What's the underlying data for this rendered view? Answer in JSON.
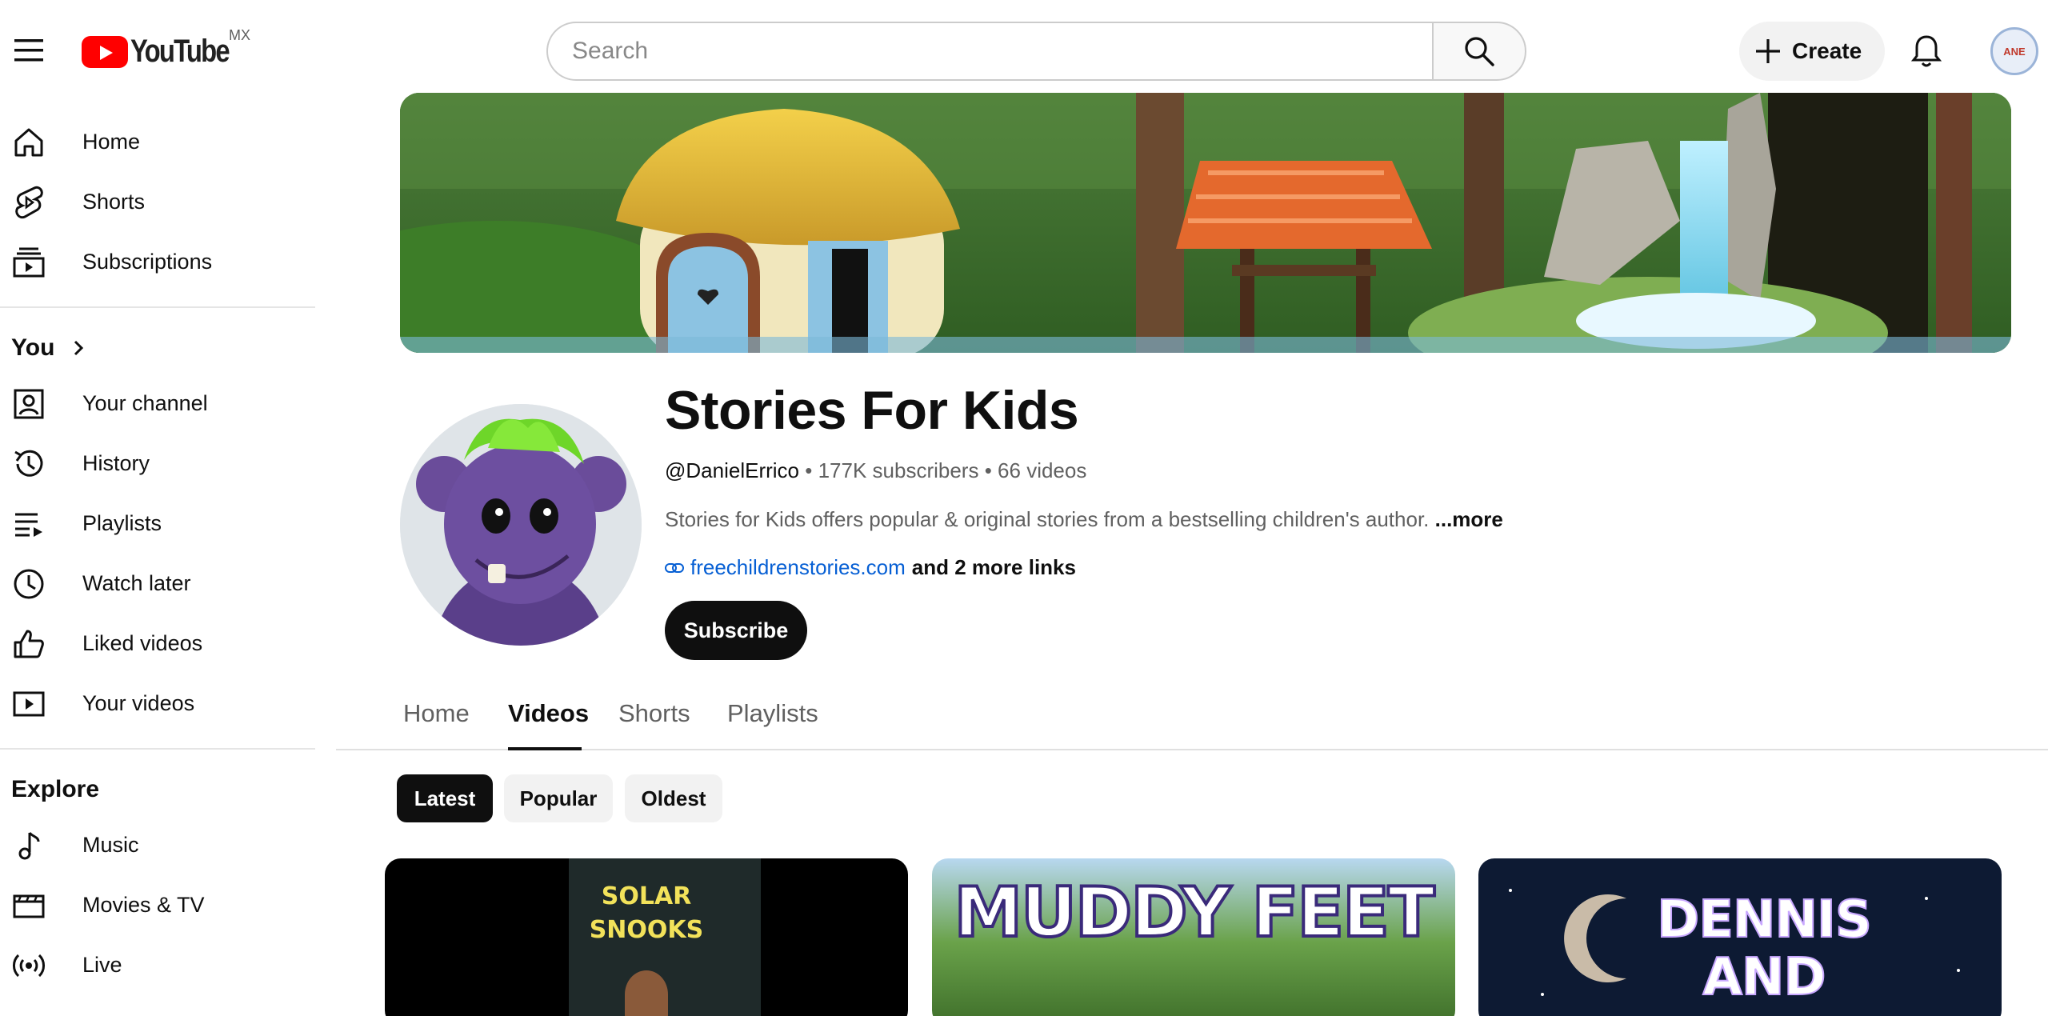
{
  "header": {
    "logo_text": "YouTube",
    "region": "MX",
    "search_placeholder": "Search",
    "create_label": "Create",
    "account_initials": "ANE"
  },
  "sidebar": {
    "top_items": [
      {
        "label": "Home",
        "icon": "home-icon"
      },
      {
        "label": "Shorts",
        "icon": "shorts-icon"
      },
      {
        "label": "Subscriptions",
        "icon": "subscriptions-icon"
      }
    ],
    "you_heading": "You",
    "you_items": [
      {
        "label": "Your channel",
        "icon": "your-channel-icon"
      },
      {
        "label": "History",
        "icon": "history-icon"
      },
      {
        "label": "Playlists",
        "icon": "playlists-icon"
      },
      {
        "label": "Watch later",
        "icon": "watch-later-icon"
      },
      {
        "label": "Liked videos",
        "icon": "liked-icon"
      },
      {
        "label": "Your videos",
        "icon": "your-videos-icon"
      }
    ],
    "explore_heading": "Explore",
    "explore_items": [
      {
        "label": "Music",
        "icon": "music-icon"
      },
      {
        "label": "Movies & TV",
        "icon": "movies-icon"
      },
      {
        "label": "Live",
        "icon": "live-icon"
      }
    ]
  },
  "channel": {
    "title": "Stories For Kids",
    "handle": "@DanielErrico",
    "subscribers": "177K subscribers",
    "videos": "66 videos",
    "separator": "•",
    "description": "Stories for Kids offers popular & original stories from a bestselling children's author.",
    "more_label": "...more",
    "link": "freechildrenstories.com",
    "more_links": "and 2 more links",
    "subscribe_label": "Subscribe"
  },
  "tabs": [
    "Home",
    "Videos",
    "Shorts",
    "Playlists"
  ],
  "active_tab": "Videos",
  "chips": [
    "Latest",
    "Popular",
    "Oldest"
  ],
  "active_chip": "Latest",
  "videos": [
    {
      "thumb_text_1": "SOLAR",
      "thumb_text_2": "SNOOKS"
    },
    {
      "thumb_text_1": "MUDDY FEET",
      "thumb_text_2": ""
    },
    {
      "thumb_text_1": "DENNIS",
      "thumb_text_2": "AND"
    }
  ],
  "colors": {
    "brand_red": "#ff0000",
    "link_blue": "#065fd4",
    "text_primary": "#0f0f0f",
    "text_secondary": "#606060"
  }
}
